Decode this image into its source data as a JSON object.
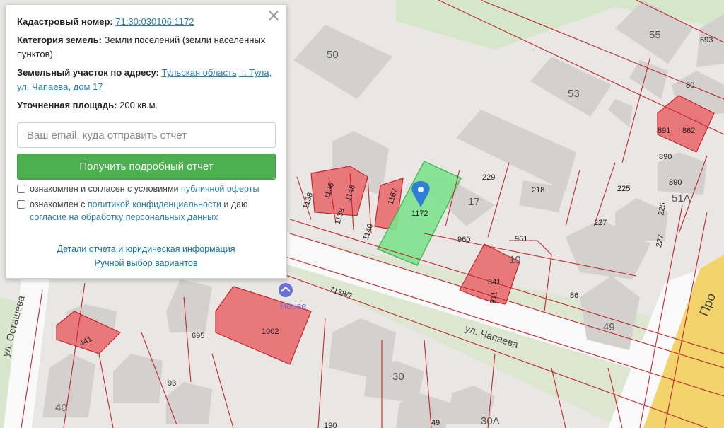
{
  "panel": {
    "cadastral_label": "Кадастровый номер:",
    "cadastral_value": "71:30:030106:1172",
    "category_label": "Категория земель:",
    "category_value": "Земли поселений (земли населенных пунктов)",
    "address_label": "Земельный участок по адресу:",
    "address_value": "Тульская область, г. Тула, ул. Чапаева, дом 17",
    "area_label": "Уточненная площадь:",
    "area_value": "200 кв.м.",
    "email_placeholder": "Ваш email, куда отправить отчет",
    "button_label": "Получить подробный отчет",
    "consent1_text": "ознакомлен и согласен с условиями ",
    "consent1_link": "публичной оферты",
    "consent2_text1": "ознакомлен с ",
    "consent2_link1": "политикой конфиденциальности",
    "consent2_text2": " и даю ",
    "consent2_link2": "согласие на обработку персональных данных",
    "footer_link1": "Детали отчета и юридическая информация",
    "footer_link2": "Ручной выбор вариантов"
  },
  "map": {
    "buildings": [
      "50",
      "55",
      "693",
      "53",
      "80",
      "891",
      "862",
      "890",
      "890",
      "51A",
      "225",
      "225",
      "227",
      "227",
      "229",
      "218",
      "17",
      "960",
      "961",
      "19",
      "341",
      "911",
      "86",
      "49",
      "1138",
      "1136",
      "1139",
      "1148",
      "1140",
      "1167",
      "1172",
      "695",
      "1002",
      "441",
      "93",
      "40",
      "30",
      "30A",
      "49",
      "190"
    ],
    "streets": [
      "ул. Чапаева",
      "ул. Осташева",
      "Про"
    ],
    "parcel_road": "7138/7",
    "poi": "House",
    "colors": {
      "selected_parcel": "#7ee28f",
      "registered": "#e9787b",
      "boundary": "#c0282f",
      "map_bg": "#e9e7e3",
      "building": "#d2d0cc",
      "road": "#ffffff",
      "green": "#c9e6b8",
      "accent": "#4caf50"
    }
  }
}
